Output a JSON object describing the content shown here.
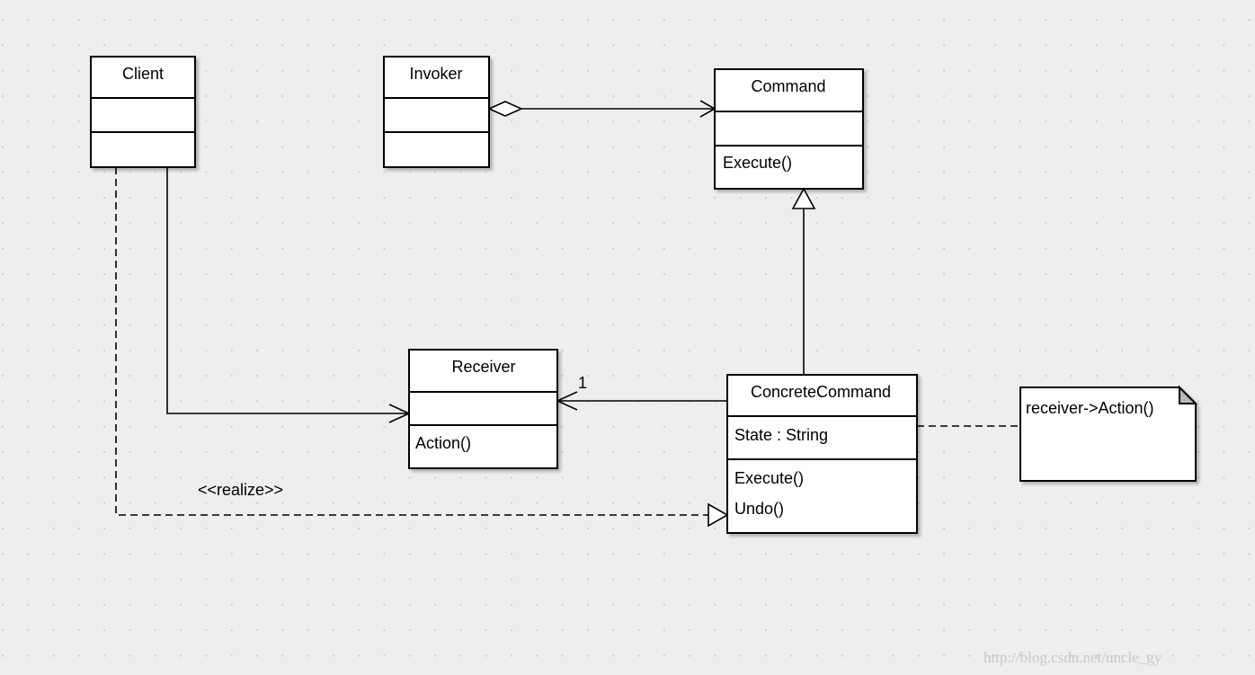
{
  "diagram": {
    "classes": [
      {
        "id": "client",
        "name": "Client",
        "attributes": [],
        "operations": []
      },
      {
        "id": "invoker",
        "name": "Invoker",
        "attributes": [],
        "operations": []
      },
      {
        "id": "command",
        "name": "Command",
        "attributes": [],
        "operations": [
          "Execute()"
        ]
      },
      {
        "id": "receiver",
        "name": "Receiver",
        "attributes": [],
        "operations": [
          "Action()"
        ]
      },
      {
        "id": "concrete",
        "name": "ConcreteCommand",
        "attributes": [
          "State : String"
        ],
        "operations": [
          "Execute()",
          "Undo()"
        ]
      }
    ],
    "note": {
      "text": "receiver->Action()"
    },
    "relations": [
      {
        "from": "invoker",
        "to": "command",
        "type": "aggregation"
      },
      {
        "from": "concrete",
        "to": "command",
        "type": "generalization"
      },
      {
        "from": "client",
        "to": "receiver",
        "type": "association"
      },
      {
        "from": "concrete",
        "to": "receiver",
        "type": "association",
        "multiplicity": "1"
      },
      {
        "from": "client",
        "to": "concrete",
        "type": "realization",
        "label": "<<realize>>"
      },
      {
        "from": "concrete",
        "to": "note",
        "type": "note-link"
      }
    ],
    "watermark": "http://blog.csdn.net/uncle_gy"
  },
  "colors": {
    "background": "#eeeeee",
    "grid_dot": "#cccccc",
    "box_fill": "#ffffff",
    "line": "#000000",
    "note_fold": "#b8b8b8"
  }
}
